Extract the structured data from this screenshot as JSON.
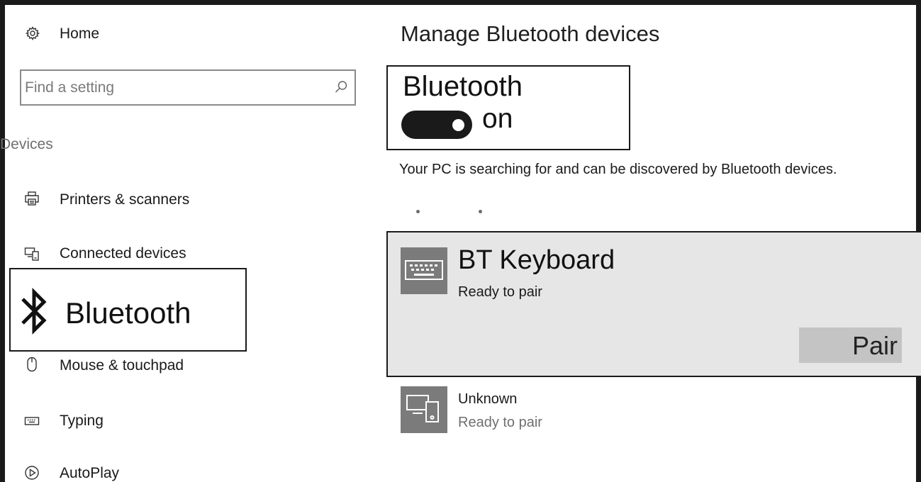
{
  "sidebar": {
    "home_label": "Home",
    "search": {
      "placeholder": "Find a setting"
    },
    "section_label": "Devices",
    "items": [
      {
        "label": "Printers & scanners",
        "icon": "printer-icon"
      },
      {
        "label": "Connected devices",
        "icon": "connected-devices-icon"
      },
      {
        "label": "Bluetooth",
        "icon": "bluetooth-icon"
      },
      {
        "label": "Mouse & touchpad",
        "icon": "mouse-icon"
      },
      {
        "label": "Typing",
        "icon": "keyboard-icon"
      },
      {
        "label": "AutoPlay",
        "icon": "autoplay-icon"
      }
    ]
  },
  "main": {
    "title": "Manage Bluetooth devices",
    "bluetooth": {
      "heading": "Bluetooth",
      "toggle_state": "on",
      "status": "Your PC is searching for and can be discovered by Bluetooth devices."
    },
    "devices": [
      {
        "name": "BT Keyboard",
        "status": "Ready to pair",
        "icon": "keyboard-device-icon",
        "action_label": "Pair"
      },
      {
        "name": "Unknown",
        "status": "Ready to pair",
        "icon": "unknown-device-icon"
      }
    ]
  },
  "colors": {
    "frame": "#1a1a1a",
    "selected_card": "#e6e6e6",
    "device_tile": "#7b7b7b",
    "pair_button": "#c4c4c4",
    "toggle_on": "#1a1a1a"
  }
}
